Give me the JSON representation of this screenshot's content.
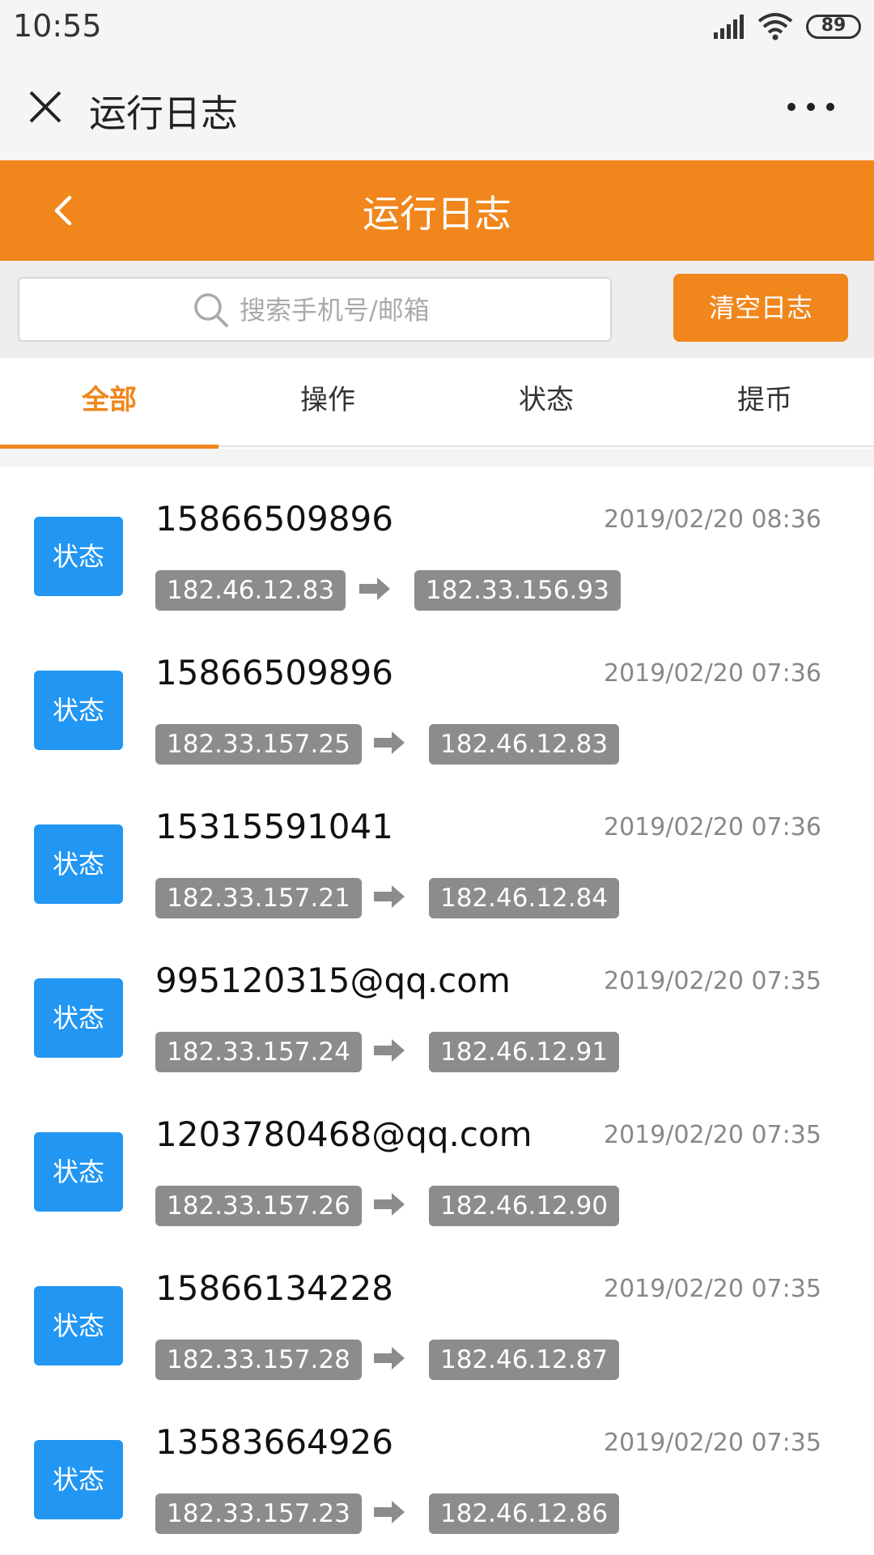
{
  "status_bar": {
    "time": "10:55",
    "battery": "89"
  },
  "wechat_bar": {
    "title": "运行日志"
  },
  "header": {
    "title": "运行日志"
  },
  "search": {
    "placeholder": "搜索手机号/邮箱",
    "value": ""
  },
  "clear_button": "清空日志",
  "tabs": [
    {
      "label": "全部",
      "active": true
    },
    {
      "label": "操作",
      "active": false
    },
    {
      "label": "状态",
      "active": false
    },
    {
      "label": "提币",
      "active": false
    }
  ],
  "logs": [
    {
      "badge": "状态",
      "account": "15866509896",
      "time": "2019/02/20 08:36",
      "from_ip": "182.46.12.83",
      "to_ip": "182.33.156.93"
    },
    {
      "badge": "状态",
      "account": "15866509896",
      "time": "2019/02/20 07:36",
      "from_ip": "182.33.157.25",
      "to_ip": "182.46.12.83"
    },
    {
      "badge": "状态",
      "account": "15315591041",
      "time": "2019/02/20 07:36",
      "from_ip": "182.33.157.21",
      "to_ip": "182.46.12.84"
    },
    {
      "badge": "状态",
      "account": "995120315@qq.com",
      "time": "2019/02/20 07:35",
      "from_ip": "182.33.157.24",
      "to_ip": "182.46.12.91"
    },
    {
      "badge": "状态",
      "account": "1203780468@qq.com",
      "time": "2019/02/20 07:35",
      "from_ip": "182.33.157.26",
      "to_ip": "182.46.12.90"
    },
    {
      "badge": "状态",
      "account": "15866134228",
      "time": "2019/02/20 07:35",
      "from_ip": "182.33.157.28",
      "to_ip": "182.46.12.87"
    },
    {
      "badge": "状态",
      "account": "13583664926",
      "time": "2019/02/20 07:35",
      "from_ip": "182.33.157.23",
      "to_ip": "182.46.12.86"
    }
  ],
  "colors": {
    "accent": "#f0861c",
    "badge": "#2196f3",
    "ip_chip": "#8c8c8c"
  }
}
